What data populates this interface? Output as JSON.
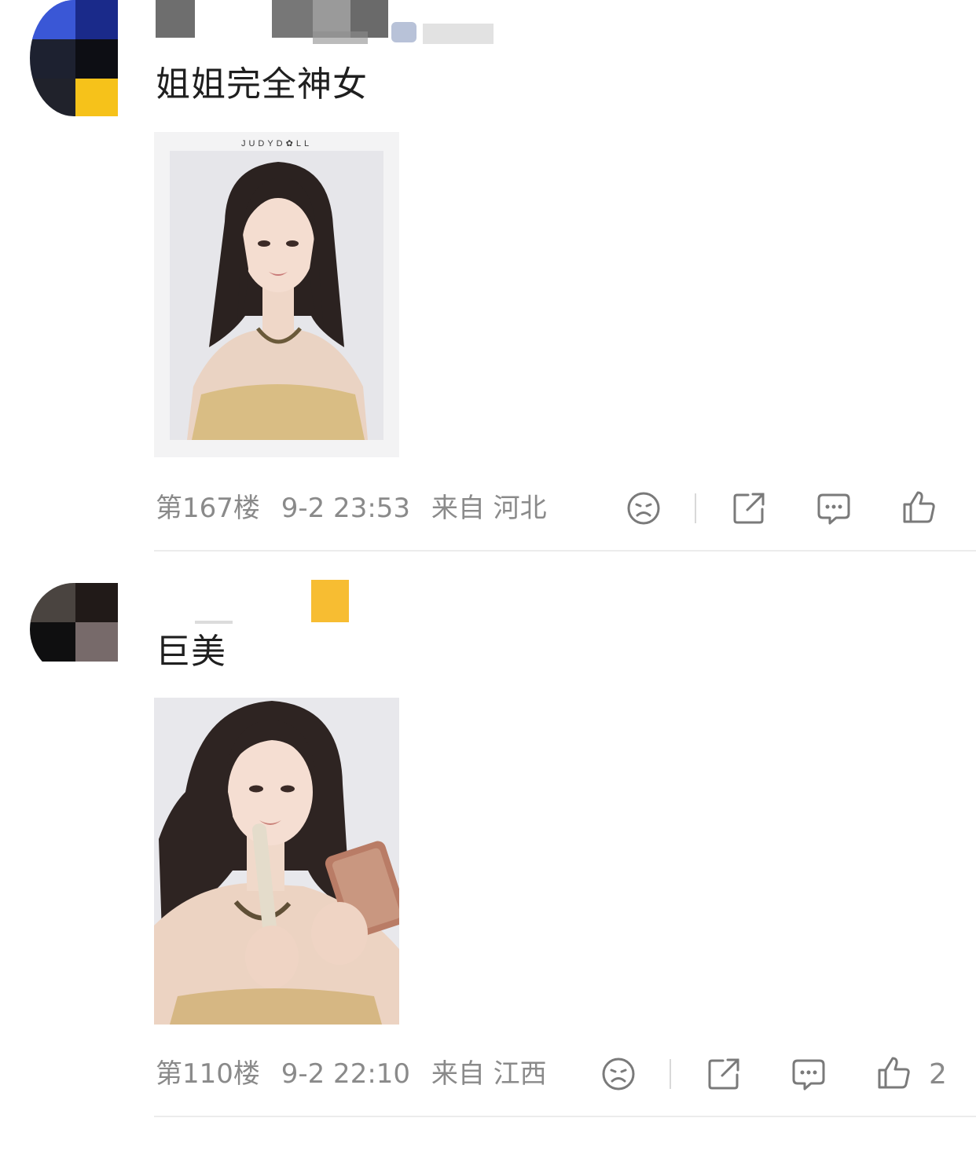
{
  "comments": [
    {
      "text": "姐姐完全神女",
      "image_brand": "JUDYD✿LL",
      "floor": "第167楼",
      "time": "9-2 23:53",
      "location": "来自 河北",
      "like_count": ""
    },
    {
      "text": "巨美",
      "floor": "第110楼",
      "time": "9-2 22:10",
      "location": "来自 江西",
      "like_count": "2"
    }
  ],
  "icons": [
    "dislike-face-icon",
    "share-icon",
    "comment-icon",
    "like-icon"
  ],
  "colors": {
    "meta_text": "#8a8a8a",
    "icon_stroke": "#7a7a7a",
    "divider": "#ececec"
  }
}
